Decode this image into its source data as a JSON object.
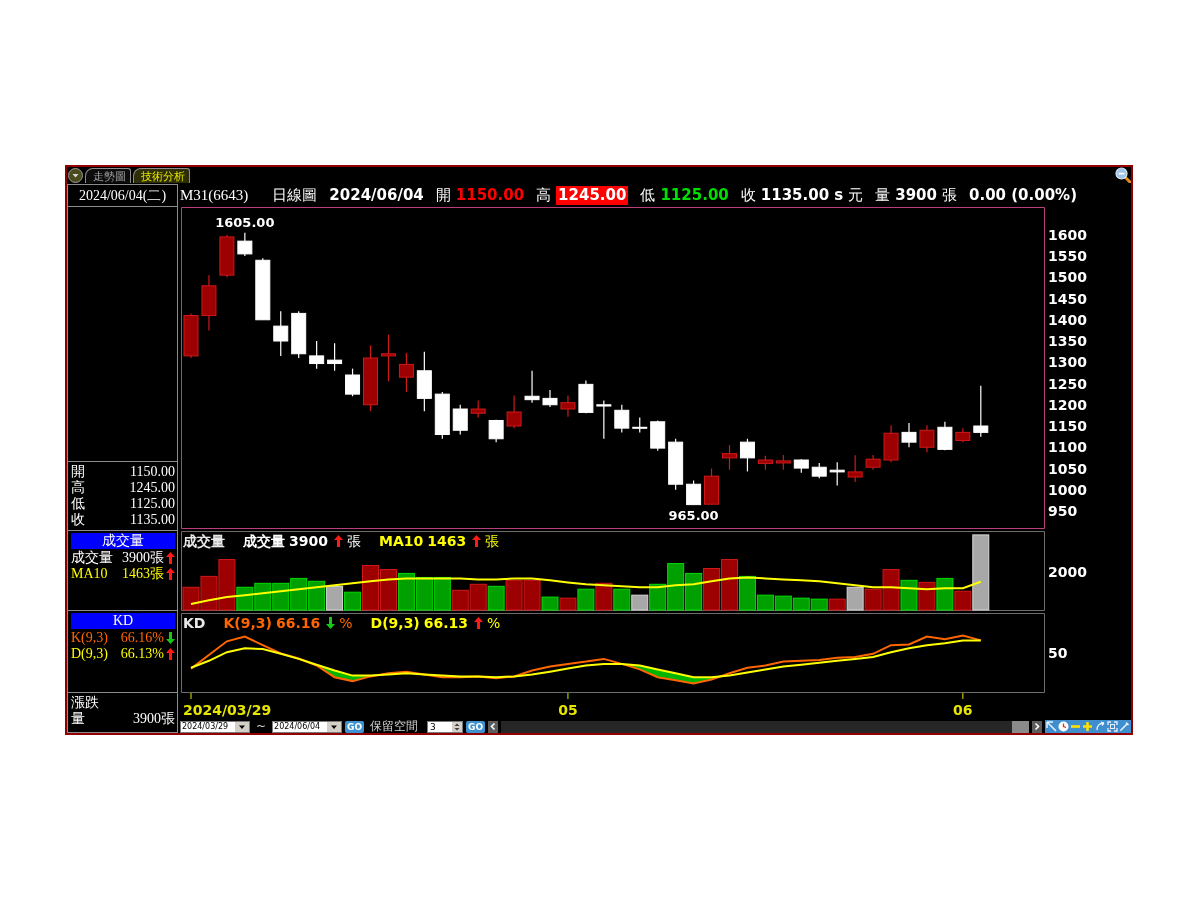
{
  "window": {
    "tabs": [
      {
        "label": "走勢圖",
        "selected": false
      },
      {
        "label": "技術分析",
        "selected": true
      }
    ]
  },
  "quote_bar": {
    "symbol": "M31(6643)",
    "period": "日線圖",
    "date": "2024/06/04",
    "fields": [
      {
        "label": "開",
        "value": "1150.00",
        "color": "#ff0000",
        "highlight": false
      },
      {
        "label": "高",
        "value": "1245.00",
        "highlight": true
      },
      {
        "label": "低",
        "value": "1125.00",
        "color": "#00e000",
        "highlight": false
      },
      {
        "label": "收",
        "value": "1135.00 s",
        "unit": "元",
        "color": "#ffffff",
        "highlight": false
      },
      {
        "label": "量",
        "value": "3900",
        "unit": "張",
        "color": "#ffffff",
        "highlight": false
      }
    ],
    "change": "0.00 (0.00%)"
  },
  "sidebar": {
    "date": "2024/06/04(二)",
    "quote": [
      {
        "label": "開",
        "value": "1150.00"
      },
      {
        "label": "高",
        "value": "1245.00"
      },
      {
        "label": "低",
        "value": "1125.00"
      },
      {
        "label": "收",
        "value": "1135.00"
      }
    ],
    "volume": {
      "title": "成交量",
      "rows": [
        {
          "label": "成交量",
          "value": "3900張",
          "up": true,
          "color": "#ffffff"
        },
        {
          "label": "MA10",
          "value": "1463張",
          "up": true,
          "color": "#ffff00"
        }
      ]
    },
    "kd": {
      "title": "KD",
      "rows": [
        {
          "label": "K(9,3)",
          "value": "66.16%",
          "up": false,
          "color": "#ff6600"
        },
        {
          "label": "D(9,3)",
          "value": "66.13%",
          "up": true,
          "color": "#ffff00"
        }
      ]
    },
    "change": [
      {
        "label": "漲跌"
      },
      {
        "label": "量",
        "value": "3900張"
      }
    ]
  },
  "price_chart": {
    "high_label": "1605.00",
    "low_label": "965.00",
    "axis_labels": [
      "1600",
      "1550",
      "1500",
      "1450",
      "1400",
      "1350",
      "1300",
      "1250",
      "1200",
      "1150",
      "1100",
      "1050",
      "1000",
      "950"
    ]
  },
  "volume_chart": {
    "title": "成交量",
    "legend": [
      {
        "label": "成交量",
        "value": "3900",
        "up": true,
        "unit": "張",
        "color": "#ffffff"
      },
      {
        "label": "MA10",
        "value": "1463",
        "up": true,
        "unit": "張",
        "color": "#ffff00"
      }
    ],
    "axis_label": "2000"
  },
  "kd_chart": {
    "title": "KD",
    "legend": [
      {
        "label": "K(9,3)",
        "value": "66.16",
        "up": false,
        "unit": "%",
        "color": "#ff6600"
      },
      {
        "label": "D(9,3)",
        "value": "66.13",
        "up": true,
        "unit": "%",
        "color": "#ffff00"
      }
    ],
    "axis_label": "50",
    "date_labels": [
      "2024/03/29",
      "05",
      "06"
    ]
  },
  "toolbar": {
    "items": [
      {
        "kind": "date",
        "value": "2024/03/29"
      },
      {
        "kind": "text",
        "text": "~"
      },
      {
        "kind": "date",
        "value": "2024/06/04"
      },
      {
        "kind": "go",
        "label": "GO"
      },
      {
        "kind": "text",
        "text": "保留空間"
      },
      {
        "kind": "spin",
        "value": "3"
      },
      {
        "kind": "go",
        "label": "GO"
      }
    ]
  }
}
